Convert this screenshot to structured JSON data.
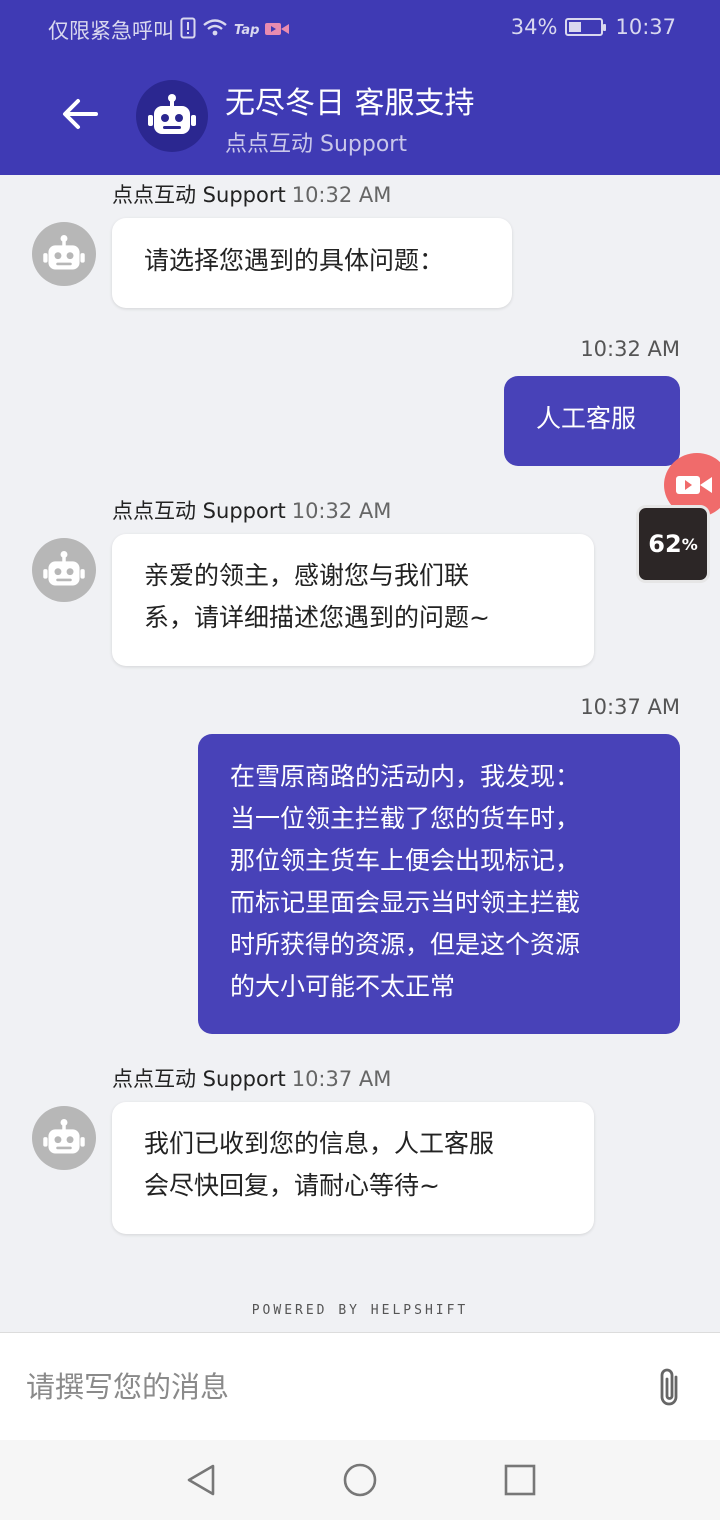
{
  "status_bar": {
    "carrier_text": "仅限紧急呼叫",
    "tap_label": "Tap",
    "battery_percent": "34%",
    "battery_level": 0.34,
    "time": "10:37"
  },
  "header": {
    "title": "无尽冬日 客服支持",
    "subtitle": "点点互动 Support"
  },
  "messages": [
    {
      "from": "bot",
      "sender": "点点互动 Support",
      "time": "10:32 AM",
      "lines": [
        "请选择您遇到的具体问题："
      ]
    },
    {
      "from": "user",
      "time": "10:32 AM",
      "lines": [
        "人工客服"
      ]
    },
    {
      "from": "bot",
      "sender": "点点互动 Support",
      "time": "10:32 AM",
      "lines": [
        "亲爱的领主，感谢您与我们联",
        "系，请详细描述您遇到的问题~"
      ]
    },
    {
      "from": "user",
      "time": "10:37 AM",
      "lines": [
        "在雪原商路的活动内，我发现：",
        "当一位领主拦截了您的货车时，",
        "那位领主货车上便会出现标记，",
        "而标记里面会显示当时领主拦截",
        "时所获得的资源，但是这个资源",
        "的大小可能不太正常"
      ]
    },
    {
      "from": "bot",
      "sender": "点点互动 Support",
      "time": "10:37 AM",
      "lines": [
        "我们已收到您的信息，人工客服",
        "会尽快回复，请耐心等待~"
      ]
    }
  ],
  "floating_widget": {
    "value": "62",
    "unit": "%"
  },
  "footer": {
    "powered_by": "POWERED BY HELPSHIFT"
  },
  "composer": {
    "placeholder": "请撰写您的消息"
  },
  "colors": {
    "header": "#3f3ab4",
    "user_bubble": "#4842b8",
    "bot_bubble": "#ffffff",
    "background": "#f0f1f4",
    "record_button": "#f06b6b"
  }
}
